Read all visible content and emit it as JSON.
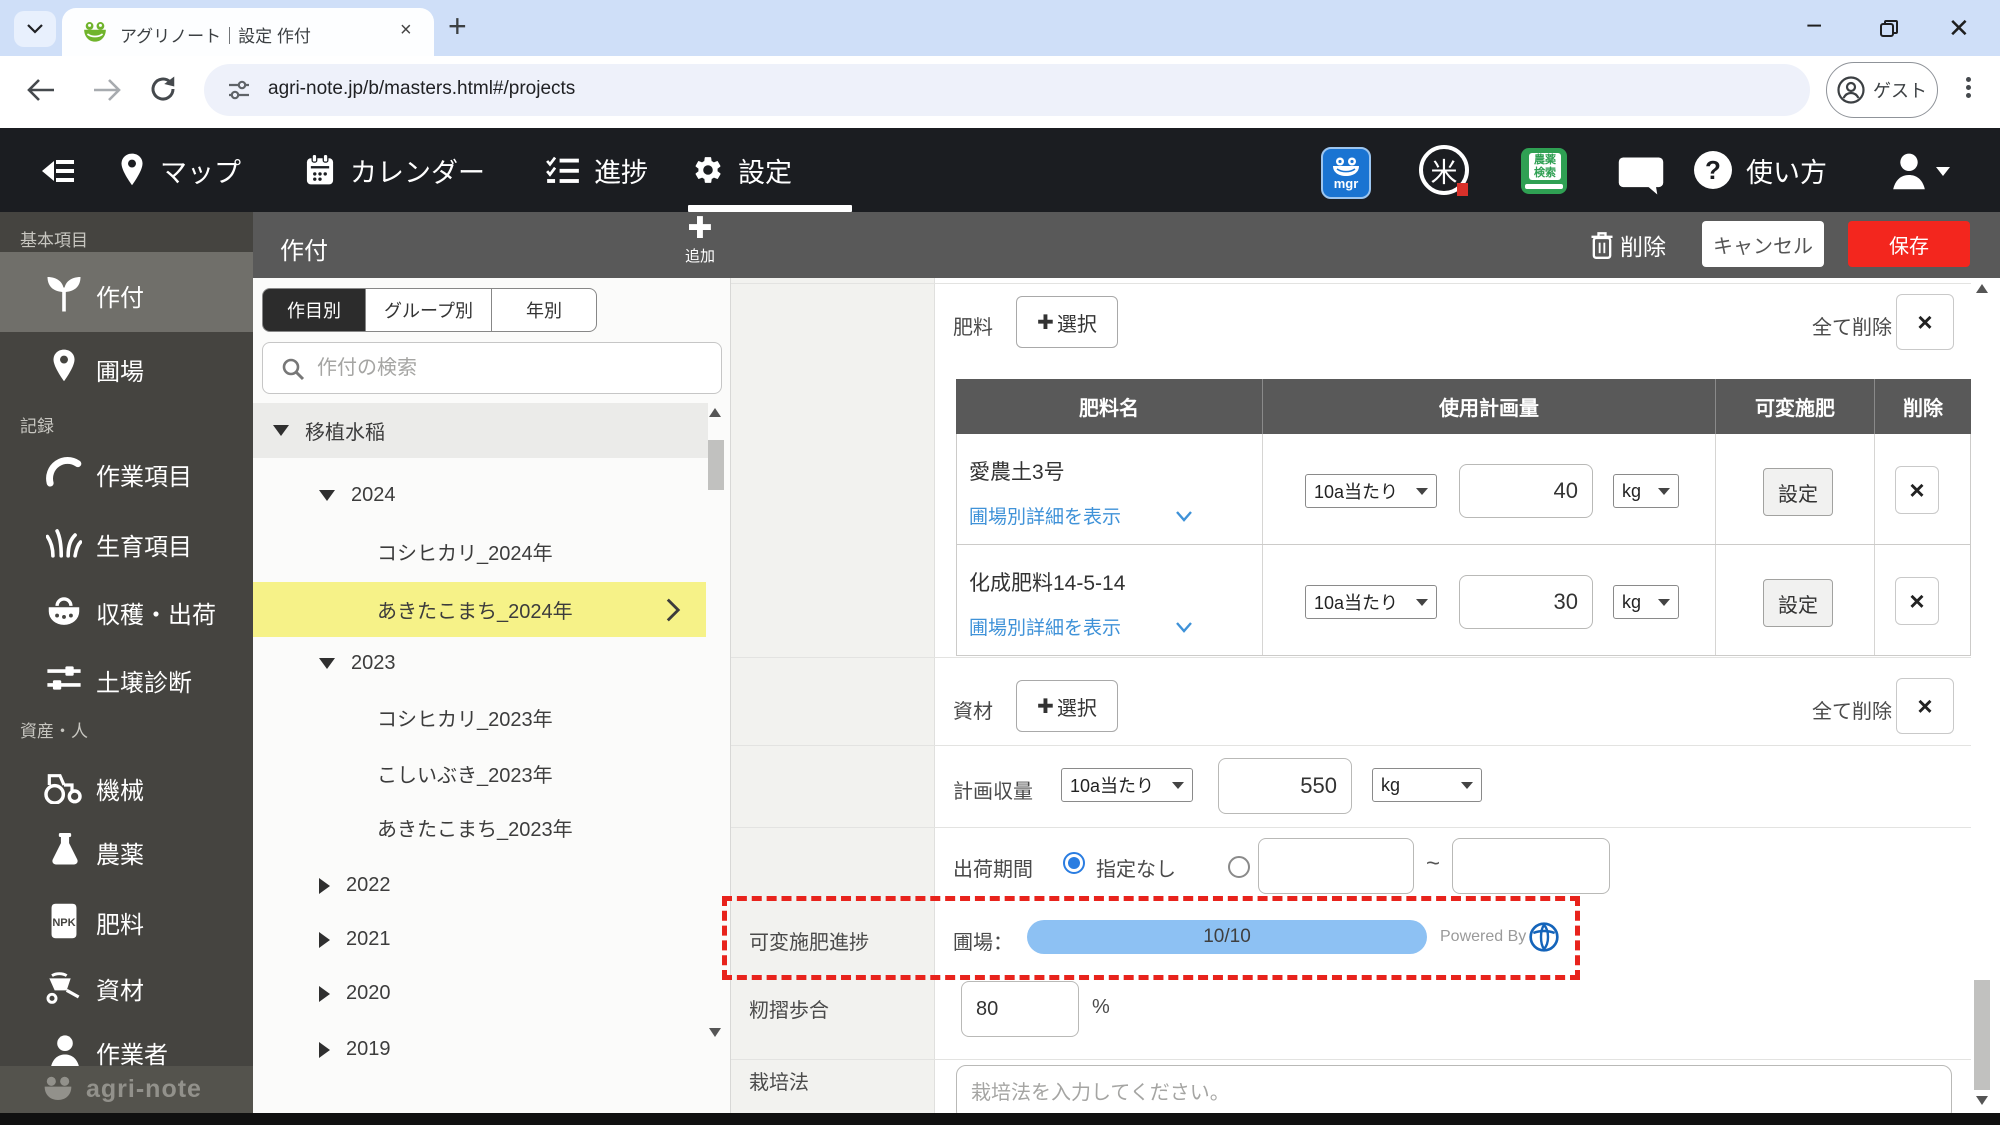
{
  "colors": {
    "accent_red": "#f3261e",
    "selection_yellow": "#f6f288",
    "link_blue": "#3f92d8",
    "progress_blue": "#8dc1f3",
    "highlight_dotted_red": "#e8231c",
    "header_gray": "#595959",
    "navbar_black": "#1b1d21",
    "sidebar_gray": "#454440"
  },
  "browser": {
    "tab_title": "アグリノート｜設定 作付",
    "url": "agri-note.jp/b/masters.html#/projects",
    "guest_label": "ゲスト"
  },
  "navbar": {
    "menu": [
      {
        "label": "マップ"
      },
      {
        "label": "カレンダー"
      },
      {
        "label": "進捗"
      },
      {
        "label": "設定"
      }
    ],
    "help_label": "使い方",
    "mgr_badge": "mgr",
    "rice_char": "米",
    "pesticide_book_line1": "農薬",
    "pesticide_book_line2": "検索"
  },
  "action_bar": {
    "title": "作付",
    "add_label": "追加",
    "delete_label": "削除",
    "cancel_label": "キャンセル",
    "save_label": "保存"
  },
  "sidebar": {
    "sections": [
      {
        "label": "基本項目",
        "items": [
          {
            "label": "作付"
          },
          {
            "label": "圃場"
          }
        ]
      },
      {
        "label": "記録",
        "items": [
          {
            "label": "作業項目"
          },
          {
            "label": "生育項目"
          },
          {
            "label": "収穫・出荷"
          },
          {
            "label": "土壌診断"
          }
        ]
      },
      {
        "label": "資産・人",
        "items": [
          {
            "label": "機械"
          },
          {
            "label": "農薬"
          },
          {
            "label": "肥料"
          },
          {
            "label": "資材"
          },
          {
            "label": "作業者"
          }
        ]
      }
    ],
    "logo_text": "agri-note"
  },
  "tree_panel": {
    "tabs": [
      {
        "label": "作目別"
      },
      {
        "label": "グループ別"
      },
      {
        "label": "年別"
      }
    ],
    "search_placeholder": "作付の検索",
    "items": [
      {
        "label": "移植水稲"
      },
      {
        "label": "2024"
      },
      {
        "label": "コシヒカリ_2024年"
      },
      {
        "label": "あきたこまち_2024年"
      },
      {
        "label": "2023"
      },
      {
        "label": "コシヒカリ_2023年"
      },
      {
        "label": "こしいぶき_2023年"
      },
      {
        "label": "あきたこまち_2023年"
      },
      {
        "label": "2022"
      },
      {
        "label": "2021"
      },
      {
        "label": "2020"
      },
      {
        "label": "2019"
      }
    ]
  },
  "form": {
    "fertilizer": {
      "label": "肥料",
      "select_label": "選択",
      "delete_all_label": "全て削除",
      "table": {
        "headers": [
          "肥料名",
          "使用計画量",
          "可変施肥",
          "削除"
        ],
        "rows": [
          {
            "name": "愛農土3号",
            "detail_link": "圃場別詳細を表示",
            "per": "10a当たり",
            "amount": "40",
            "unit": "kg",
            "config_label": "設定"
          },
          {
            "name": "化成肥料14-5-14",
            "detail_link": "圃場別詳細を表示",
            "per": "10a当たり",
            "amount": "30",
            "unit": "kg",
            "config_label": "設定"
          }
        ]
      }
    },
    "material": {
      "label": "資材",
      "select_label": "選択",
      "delete_all_label": "全て削除"
    },
    "planned_yield": {
      "label": "計画収量",
      "per": "10a当たり",
      "amount": "550",
      "unit": "kg"
    },
    "shipping_period": {
      "label": "出荷期間",
      "no_spec_label": "指定なし",
      "separator": "~"
    },
    "vrf_progress": {
      "label": "可変施肥進捗",
      "field_label": "圃場：",
      "progress_text": "10/10",
      "powered_by_label": "Powered By"
    },
    "hulling_ratio": {
      "label": "籾摺歩合",
      "value": "80",
      "unit": "%"
    },
    "cultivation": {
      "label": "栽培法",
      "placeholder": "栽培法を入力してください。"
    }
  }
}
